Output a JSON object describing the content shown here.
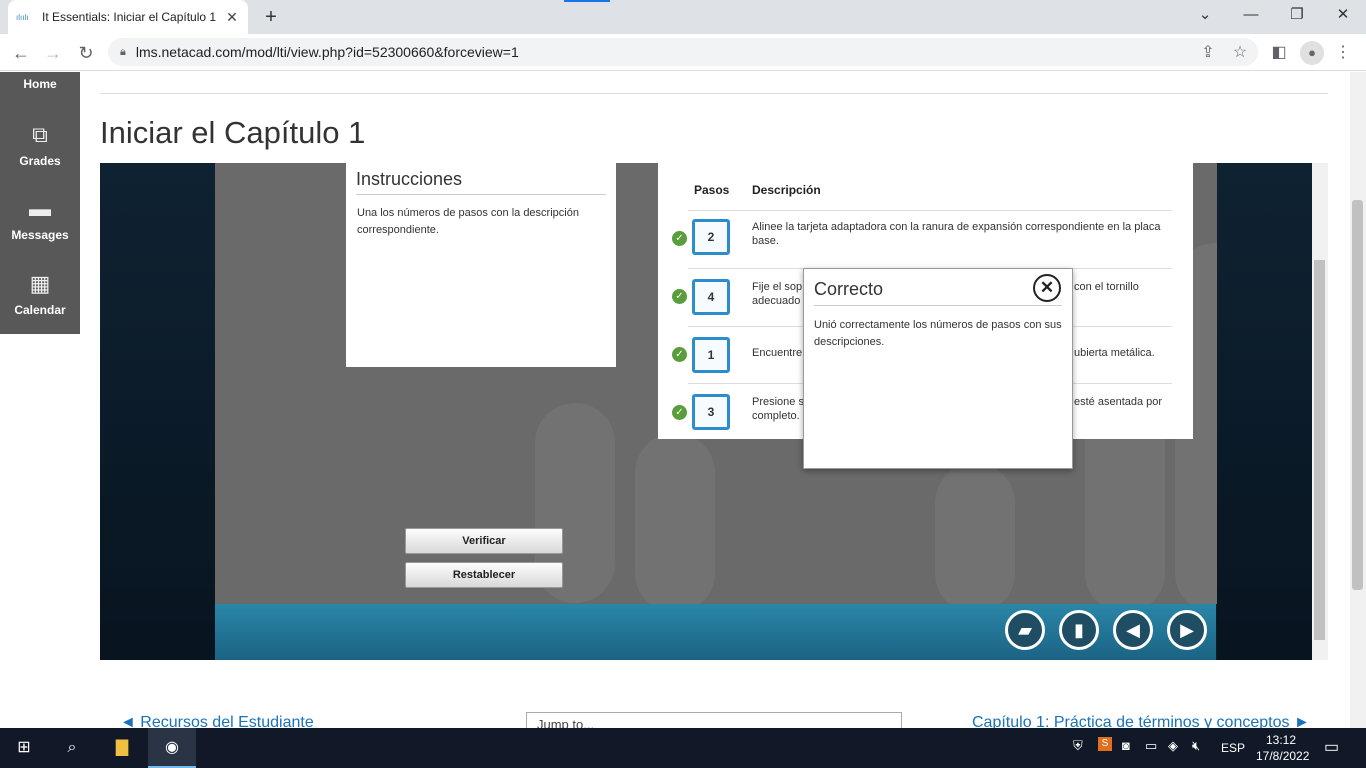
{
  "browser": {
    "tab_title": "It Essentials: Iniciar el Capítulo 1",
    "tab_favicon": "cisco",
    "url": "lms.netacad.com/mod/lti/view.php?id=52300660&forceview=1"
  },
  "sidebar": {
    "items": [
      {
        "label": "Home",
        "icon": "home-icon"
      },
      {
        "label": "Grades",
        "icon": "grades-icon"
      },
      {
        "label": "Messages",
        "icon": "messages-icon"
      },
      {
        "label": "Calendar",
        "icon": "calendar-icon"
      }
    ]
  },
  "page": {
    "title": "Iniciar el Capítulo 1"
  },
  "activity": {
    "instructions_title": "Instrucciones",
    "instructions_text": "Una los números de pasos con la descripción correspondiente.",
    "col_steps": "Pasos",
    "col_description": "Descripción",
    "rows": [
      {
        "step": "2",
        "description": "Alinee la tarjeta adaptadora con la ranura de expansión correspondiente en la placa base."
      },
      {
        "step": "4",
        "description_left": "Fije el sop",
        "description_left2": "adecuado",
        "description_right": "con el tornillo"
      },
      {
        "step": "1",
        "description_left": "Encuentre",
        "description_right": "ubierta metálica."
      },
      {
        "step": "3",
        "description_left": "Presione s",
        "description_left2": "completo.",
        "description_right": "esté asentada por"
      }
    ],
    "verify_label": "Verificar",
    "reset_label": "Restablecer"
  },
  "modal": {
    "title": "Correcto",
    "text": "Unió correctamente los números de pasos con sus descripciones."
  },
  "lms_nav": {
    "prev": "◄ Recursos del Estudiante",
    "jump": "Jump to...",
    "next": "Capítulo 1: Práctica de términos y conceptos ►"
  },
  "taskbar": {
    "language": "ESP",
    "time": "13:12",
    "date": "17/8/2022"
  },
  "colors": {
    "accent": "#2d8dcc",
    "check": "#5a9d3c",
    "link": "#1a72b8"
  }
}
